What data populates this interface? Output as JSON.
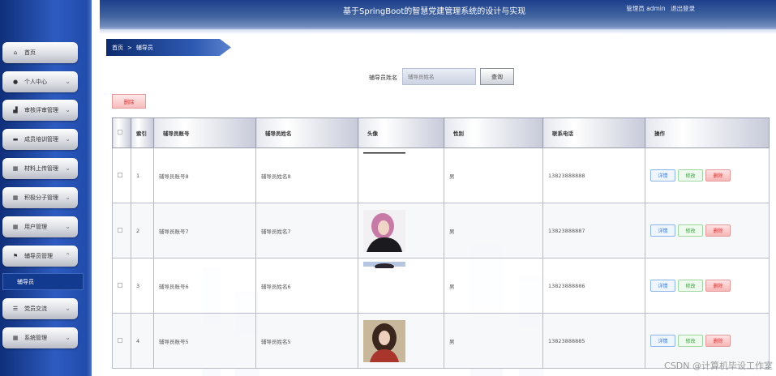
{
  "header": {
    "title": "基于SpringBoot的智慧党建管理系统的设计与实现",
    "user_label": "管理员 admin",
    "logout": "退出登录"
  },
  "sidebar": {
    "items": [
      {
        "label": "首页",
        "icon": "home-icon"
      },
      {
        "label": "个人中心",
        "icon": "user-icon"
      },
      {
        "label": "审核评审管理",
        "icon": "bar-chart-icon"
      },
      {
        "label": "成员培训管理",
        "icon": "monitor-icon"
      },
      {
        "label": "材料上传管理",
        "icon": "grid-icon"
      },
      {
        "label": "积极分子管理",
        "icon": "grid-icon"
      },
      {
        "label": "用户管理",
        "icon": "grid-icon"
      },
      {
        "label": "辅导员管理",
        "icon": "flag-icon"
      },
      {
        "label": "党员交流",
        "icon": "menu-icon"
      },
      {
        "label": "系统管理",
        "icon": "grid-icon"
      }
    ],
    "submenu_active": "辅导员"
  },
  "breadcrumb": {
    "home": "首页",
    "separator": ">",
    "current": "辅导员"
  },
  "search": {
    "label": "辅导员姓名",
    "placeholder": "辅导员姓名",
    "button": "查询"
  },
  "bulk_delete": "删除",
  "table": {
    "headers": [
      "",
      "索引",
      "辅导员账号",
      "辅导员姓名",
      "头像",
      "性别",
      "联系电话",
      "操作"
    ],
    "rows": [
      {
        "index": "1",
        "account": "辅导员账号8",
        "name": "辅导员姓名8",
        "gender": "男",
        "phone": "13823888888",
        "avatar": "partial"
      },
      {
        "index": "2",
        "account": "辅导员账号7",
        "name": "辅导员姓名7",
        "gender": "男",
        "phone": "13823888887",
        "avatar": "photo-pink"
      },
      {
        "index": "3",
        "account": "辅导员账号6",
        "name": "辅导员姓名6",
        "gender": "男",
        "phone": "13823888886",
        "avatar": "partial"
      },
      {
        "index": "4",
        "account": "辅导员账号5",
        "name": "辅导员姓名5",
        "gender": "男",
        "phone": "13823888885",
        "avatar": "photo-brown"
      }
    ],
    "actions": {
      "detail": "详情",
      "edit": "修改",
      "delete": "删除"
    }
  },
  "watermark": "CSDN @计算机毕设工作室"
}
